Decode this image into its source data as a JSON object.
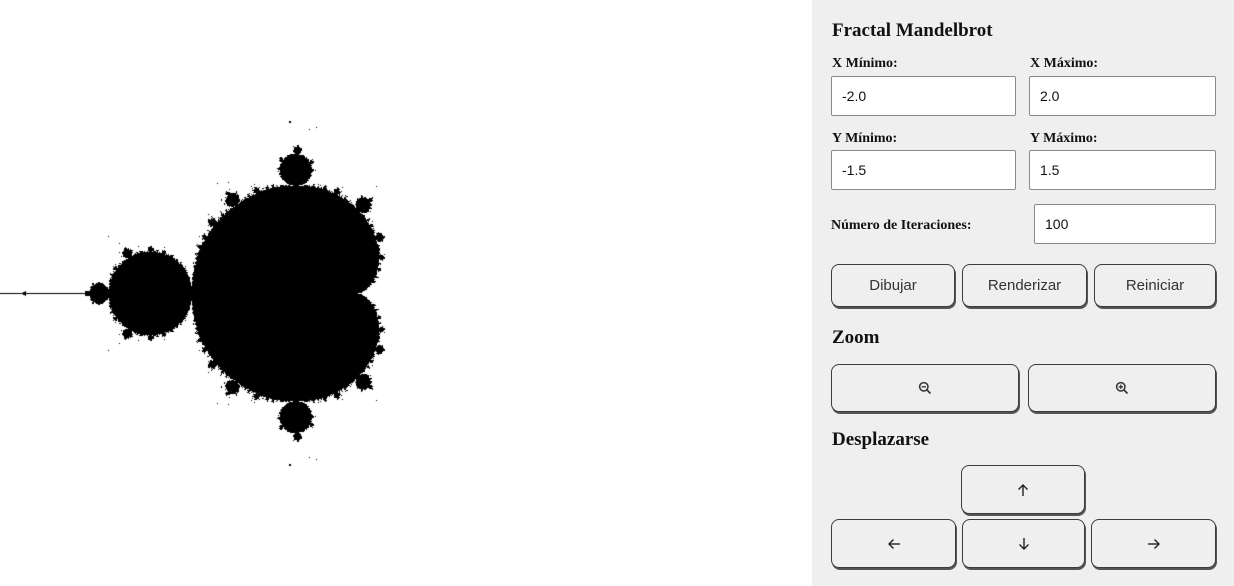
{
  "panel": {
    "title": "Fractal Mandelbrot",
    "x_min": {
      "label": "X Mínimo:",
      "value": "-2.0"
    },
    "x_max": {
      "label": "X Máximo:",
      "value": "2.0"
    },
    "y_min": {
      "label": "Y Mínimo:",
      "value": "-1.5"
    },
    "y_max": {
      "label": "Y Máximo:",
      "value": "1.5"
    },
    "iterations": {
      "label": "Número de Iteraciones:",
      "value": "100"
    },
    "buttons": {
      "draw": "Dibujar",
      "render": "Renderizar",
      "reset": "Reiniciar"
    }
  },
  "zoom": {
    "title": "Zoom",
    "out_icon": "zoom-out-icon",
    "in_icon": "zoom-in-icon"
  },
  "pan": {
    "title": "Desplazarse",
    "up_icon": "arrow-up-icon",
    "left_icon": "arrow-left-icon",
    "down_icon": "arrow-down-icon",
    "right_icon": "arrow-right-icon"
  },
  "colors": {
    "fractal": "#000000",
    "background": "#ffffff",
    "panel": "#efefef"
  }
}
